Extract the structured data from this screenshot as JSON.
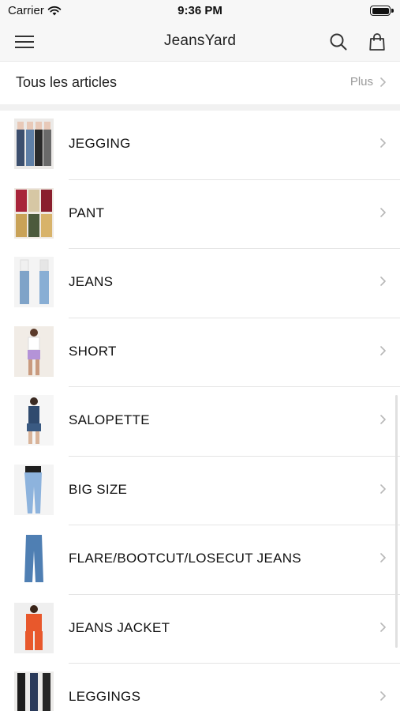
{
  "status_bar": {
    "carrier": "Carrier",
    "time": "9:36 PM"
  },
  "nav": {
    "title": "JeansYard",
    "menu_icon": "hamburger-menu-icon",
    "search_icon": "search-icon",
    "cart_icon": "shopping-bag-icon"
  },
  "section": {
    "title": "Tous les articles",
    "more_label": "Plus"
  },
  "categories": [
    {
      "label": "JEGGING"
    },
    {
      "label": "PANT"
    },
    {
      "label": "JEANS"
    },
    {
      "label": "SHORT"
    },
    {
      "label": "SALOPETTE"
    },
    {
      "label": "BIG SIZE"
    },
    {
      "label": "FLARE/BOOTCUT/LOSECUT JEANS"
    },
    {
      "label": "JEANS JACKET"
    },
    {
      "label": "LEGGINGS"
    }
  ],
  "colors": {
    "nav_bg": "#f7f7f7",
    "divider": "#e4e4e4",
    "muted_text": "#9a9a9a",
    "chevron": "#b8b8b8"
  }
}
